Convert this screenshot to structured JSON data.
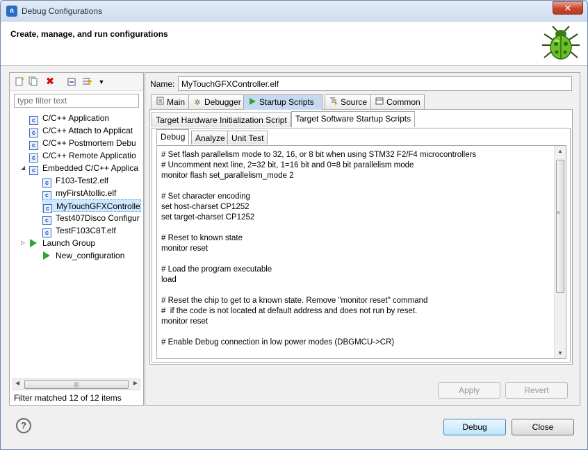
{
  "window": {
    "title": "Debug Configurations",
    "close_glyph": "✕"
  },
  "banner": {
    "title": "Create, manage, and run configurations"
  },
  "toolbar": {
    "icons": [
      "new-config-icon",
      "duplicate-icon",
      "delete-icon",
      "collapse-all-icon",
      "filter-icon",
      "view-menu-icon"
    ]
  },
  "filter": {
    "placeholder": "type filter text"
  },
  "tree": {
    "items": [
      {
        "label": "C/C++ Application",
        "type": "category"
      },
      {
        "label": "C/C++ Attach to Applicat",
        "type": "category"
      },
      {
        "label": "C/C++ Postmortem Debu",
        "type": "category"
      },
      {
        "label": "C/C++ Remote Applicatio",
        "type": "category"
      },
      {
        "label": "Embedded C/C++ Applica",
        "type": "category-expanded"
      },
      {
        "label": "F103-Test2.elf",
        "type": "config"
      },
      {
        "label": "myFirstAtollic.elf",
        "type": "config"
      },
      {
        "label": "MyTouchGFXControlle",
        "type": "config-selected"
      },
      {
        "label": "Test407Disco Configur",
        "type": "config"
      },
      {
        "label": "TestF103C8T.elf",
        "type": "config"
      },
      {
        "label": "Launch Group",
        "type": "launch-category"
      },
      {
        "label": "New_configuration",
        "type": "launch-config"
      }
    ],
    "scroll_grip": "|||"
  },
  "filter_status": "Filter matched 12 of 12 items",
  "name_label": "Name:",
  "name_value": "MyTouchGFXController.elf",
  "tabs": [
    {
      "label": "Main",
      "icon": "main-tab-icon"
    },
    {
      "label": "Debugger",
      "icon": "debugger-icon"
    },
    {
      "label": "Startup Scripts",
      "icon": "startup-scripts-icon",
      "active": true
    },
    {
      "label": "Source",
      "icon": "source-icon"
    },
    {
      "label": "Common",
      "icon": "common-icon"
    }
  ],
  "subtabs": [
    {
      "label": "Target Hardware Initialization Script"
    },
    {
      "label": "Target Software Startup Scripts",
      "active": true
    }
  ],
  "innertabs": [
    {
      "label": "Debug",
      "active": true
    },
    {
      "label": "Analyze"
    },
    {
      "label": "Unit Test"
    }
  ],
  "script_text": "# Set flash parallelism mode to 32, 16, or 8 bit when using STM32 F2/F4 microcontrollers\n# Uncomment next line, 2=32 bit, 1=16 bit and 0=8 bit parallelism mode\nmonitor flash set_parallelism_mode 2\n\n# Set character encoding\nset host-charset CP1252\nset target-charset CP1252\n\n# Reset to known state\nmonitor reset\n\n# Load the program executable\nload\n\n# Reset the chip to get to a known state. Remove \"monitor reset\" command\n#  if the code is not located at default address and does not run by reset.\nmonitor reset\n\n# Enable Debug connection in low power modes (DBGMCU->CR)",
  "buttons": {
    "apply": "Apply",
    "revert": "Revert",
    "debug": "Debug",
    "close": "Close",
    "help": "?"
  }
}
